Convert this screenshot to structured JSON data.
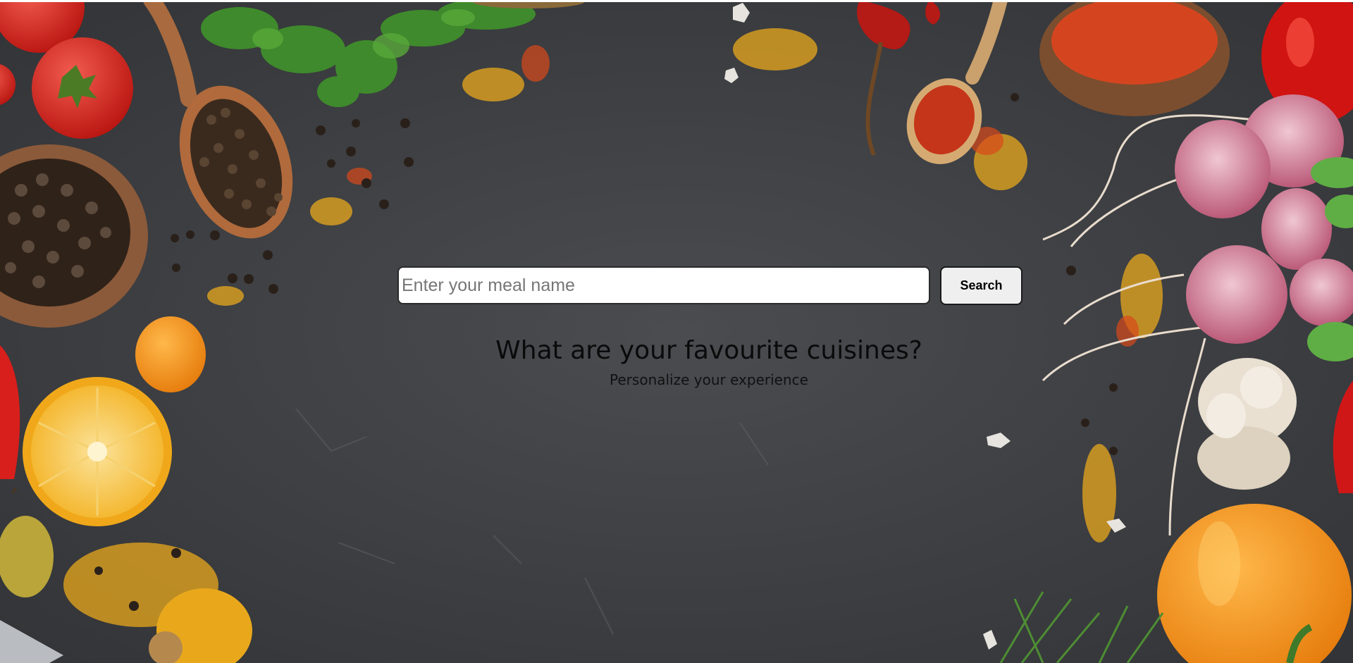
{
  "search": {
    "placeholder": "Enter your meal name",
    "value": "",
    "button_label": "Search"
  },
  "hero": {
    "heading": "What are your favourite cuisines?",
    "subheading": "Personalize your experience"
  },
  "background": {
    "image": "spices-and-vegetables-on-dark-slate",
    "colors": {
      "slate": "#3d3f43",
      "tomato": "#d8231f",
      "pepper_orange": "#f08a12",
      "lemon": "#f4b323",
      "turmeric": "#e9a81c",
      "wood": "#9b5a33",
      "radish": "#c25a78",
      "parsley": "#3f8a2c"
    }
  }
}
